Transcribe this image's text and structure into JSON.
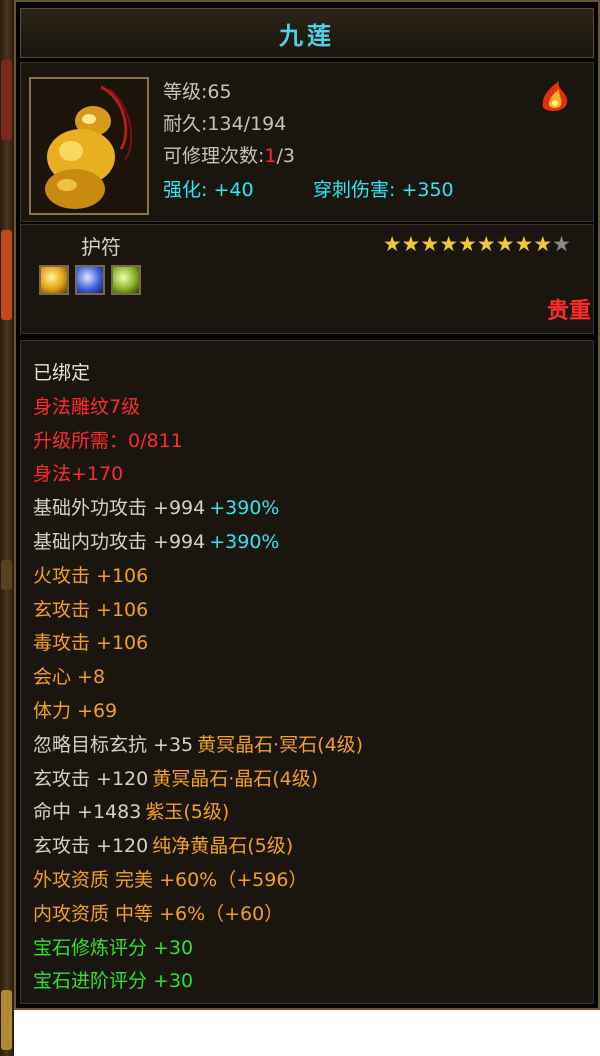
{
  "colors": {
    "white": "#e4e4dc",
    "red": "#ff2b2b",
    "orange": "#f0a020",
    "cyan": "#2ee6f0",
    "green": "#2fe02f",
    "light": "#d8d0c0",
    "title": "#4fd1e9"
  },
  "item": {
    "name": "九莲",
    "image_icon": "jade-pendant-icon",
    "attack_icon": "fire-skill-icon",
    "level": "等级:65",
    "durability": "耐久:134/194",
    "repair_label": "可修理次数:",
    "repair_used": "1",
    "repair_total": "/3",
    "enhance": "强化: +40",
    "pierce": "穿刺伤害: +350",
    "category": "护符",
    "bind_state": "贵重",
    "stars_filled": 9,
    "stars_total": 10,
    "gem_slots": [
      "yellow-gem-icon",
      "blue-gem-icon",
      "green-gem-icon"
    ]
  },
  "stats": [
    {
      "parts": [
        {
          "text": "已绑定",
          "color": "white"
        }
      ]
    },
    {
      "parts": [
        {
          "text": "身法雕纹7级",
          "color": "red"
        }
      ]
    },
    {
      "parts": [
        {
          "text": "升级所需：0/811",
          "color": "red"
        }
      ]
    },
    {
      "parts": [
        {
          "text": "身法+170",
          "color": "red"
        }
      ]
    },
    {
      "parts": [
        {
          "text": "基础外功攻击 +994",
          "color": "light"
        },
        {
          "text": "+390%",
          "color": "cyan"
        }
      ]
    },
    {
      "parts": [
        {
          "text": "基础内功攻击 +994",
          "color": "light"
        },
        {
          "text": "+390%",
          "color": "cyan"
        }
      ]
    },
    {
      "parts": [
        {
          "text": "火攻击 +106",
          "color": "orange"
        }
      ]
    },
    {
      "parts": [
        {
          "text": "玄攻击 +106",
          "color": "orange"
        }
      ]
    },
    {
      "parts": [
        {
          "text": "毒攻击 +106",
          "color": "orange"
        }
      ]
    },
    {
      "parts": [
        {
          "text": "会心 +8",
          "color": "orange"
        }
      ]
    },
    {
      "parts": [
        {
          "text": "体力 +69",
          "color": "orange"
        }
      ]
    },
    {
      "parts": [
        {
          "text": "忽略目标玄抗 +35",
          "color": "light"
        },
        {
          "text": "黄冥晶石·冥石(4级)",
          "color": "orange"
        }
      ]
    },
    {
      "parts": [
        {
          "text": "玄攻击 +120",
          "color": "light"
        },
        {
          "text": "黄冥晶石·晶石(4级)",
          "color": "orange"
        }
      ]
    },
    {
      "parts": [
        {
          "text": "命中 +1483",
          "color": "light"
        },
        {
          "text": "紫玉(5级)",
          "color": "orange"
        }
      ]
    },
    {
      "parts": [
        {
          "text": "玄攻击 +120",
          "color": "light"
        },
        {
          "text": "纯净黄晶石(5级)",
          "color": "orange"
        }
      ]
    },
    {
      "parts": [
        {
          "text": "外攻资质  完美 +60%（+596）",
          "color": "orange"
        }
      ]
    },
    {
      "parts": [
        {
          "text": "内攻资质  中等 +6%（+60）",
          "color": "orange"
        }
      ]
    },
    {
      "parts": [
        {
          "text": "宝石修炼评分 +30",
          "color": "green"
        }
      ]
    },
    {
      "parts": [
        {
          "text": "宝石进阶评分 +30",
          "color": "green"
        }
      ]
    }
  ]
}
